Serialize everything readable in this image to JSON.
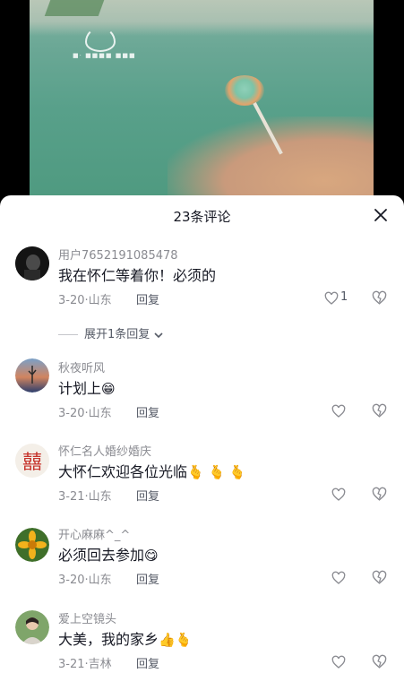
{
  "video": {
    "logo_text": "■·  ■■■■  ■■■"
  },
  "sheet": {
    "title": "23条评论"
  },
  "comments": [
    {
      "username": "用户7652191085478",
      "content": "我在怀仁等着你！必须的",
      "date": "3-20",
      "location": "山东",
      "reply_label": "回复",
      "likes": "1",
      "expand_label": "展开1条回复"
    },
    {
      "username": "秋夜听风",
      "content": "计划上",
      "emoji": "😁",
      "date": "3-20",
      "location": "山东",
      "reply_label": "回复"
    },
    {
      "username": "怀仁名人婚纱婚庆",
      "content": "大怀仁欢迎各位光临",
      "emoji": "🫰 🫰 🫰",
      "avatar_char": "囍",
      "date": "3-21",
      "location": "山东",
      "reply_label": "回复"
    },
    {
      "username": "开心麻麻^_^",
      "content": "必须回去参加",
      "emoji": "😋",
      "date": "3-20",
      "location": "山东",
      "reply_label": "回复"
    },
    {
      "username": "爱上空镜头",
      "content": "大美，我的家乡",
      "emoji": "👍🫰",
      "date": "3-21",
      "location": "吉林",
      "reply_label": "回复"
    }
  ],
  "colors": {
    "primary_text": "#161823",
    "secondary_text": "#8a8b91",
    "accent_red": "#c6342c"
  }
}
